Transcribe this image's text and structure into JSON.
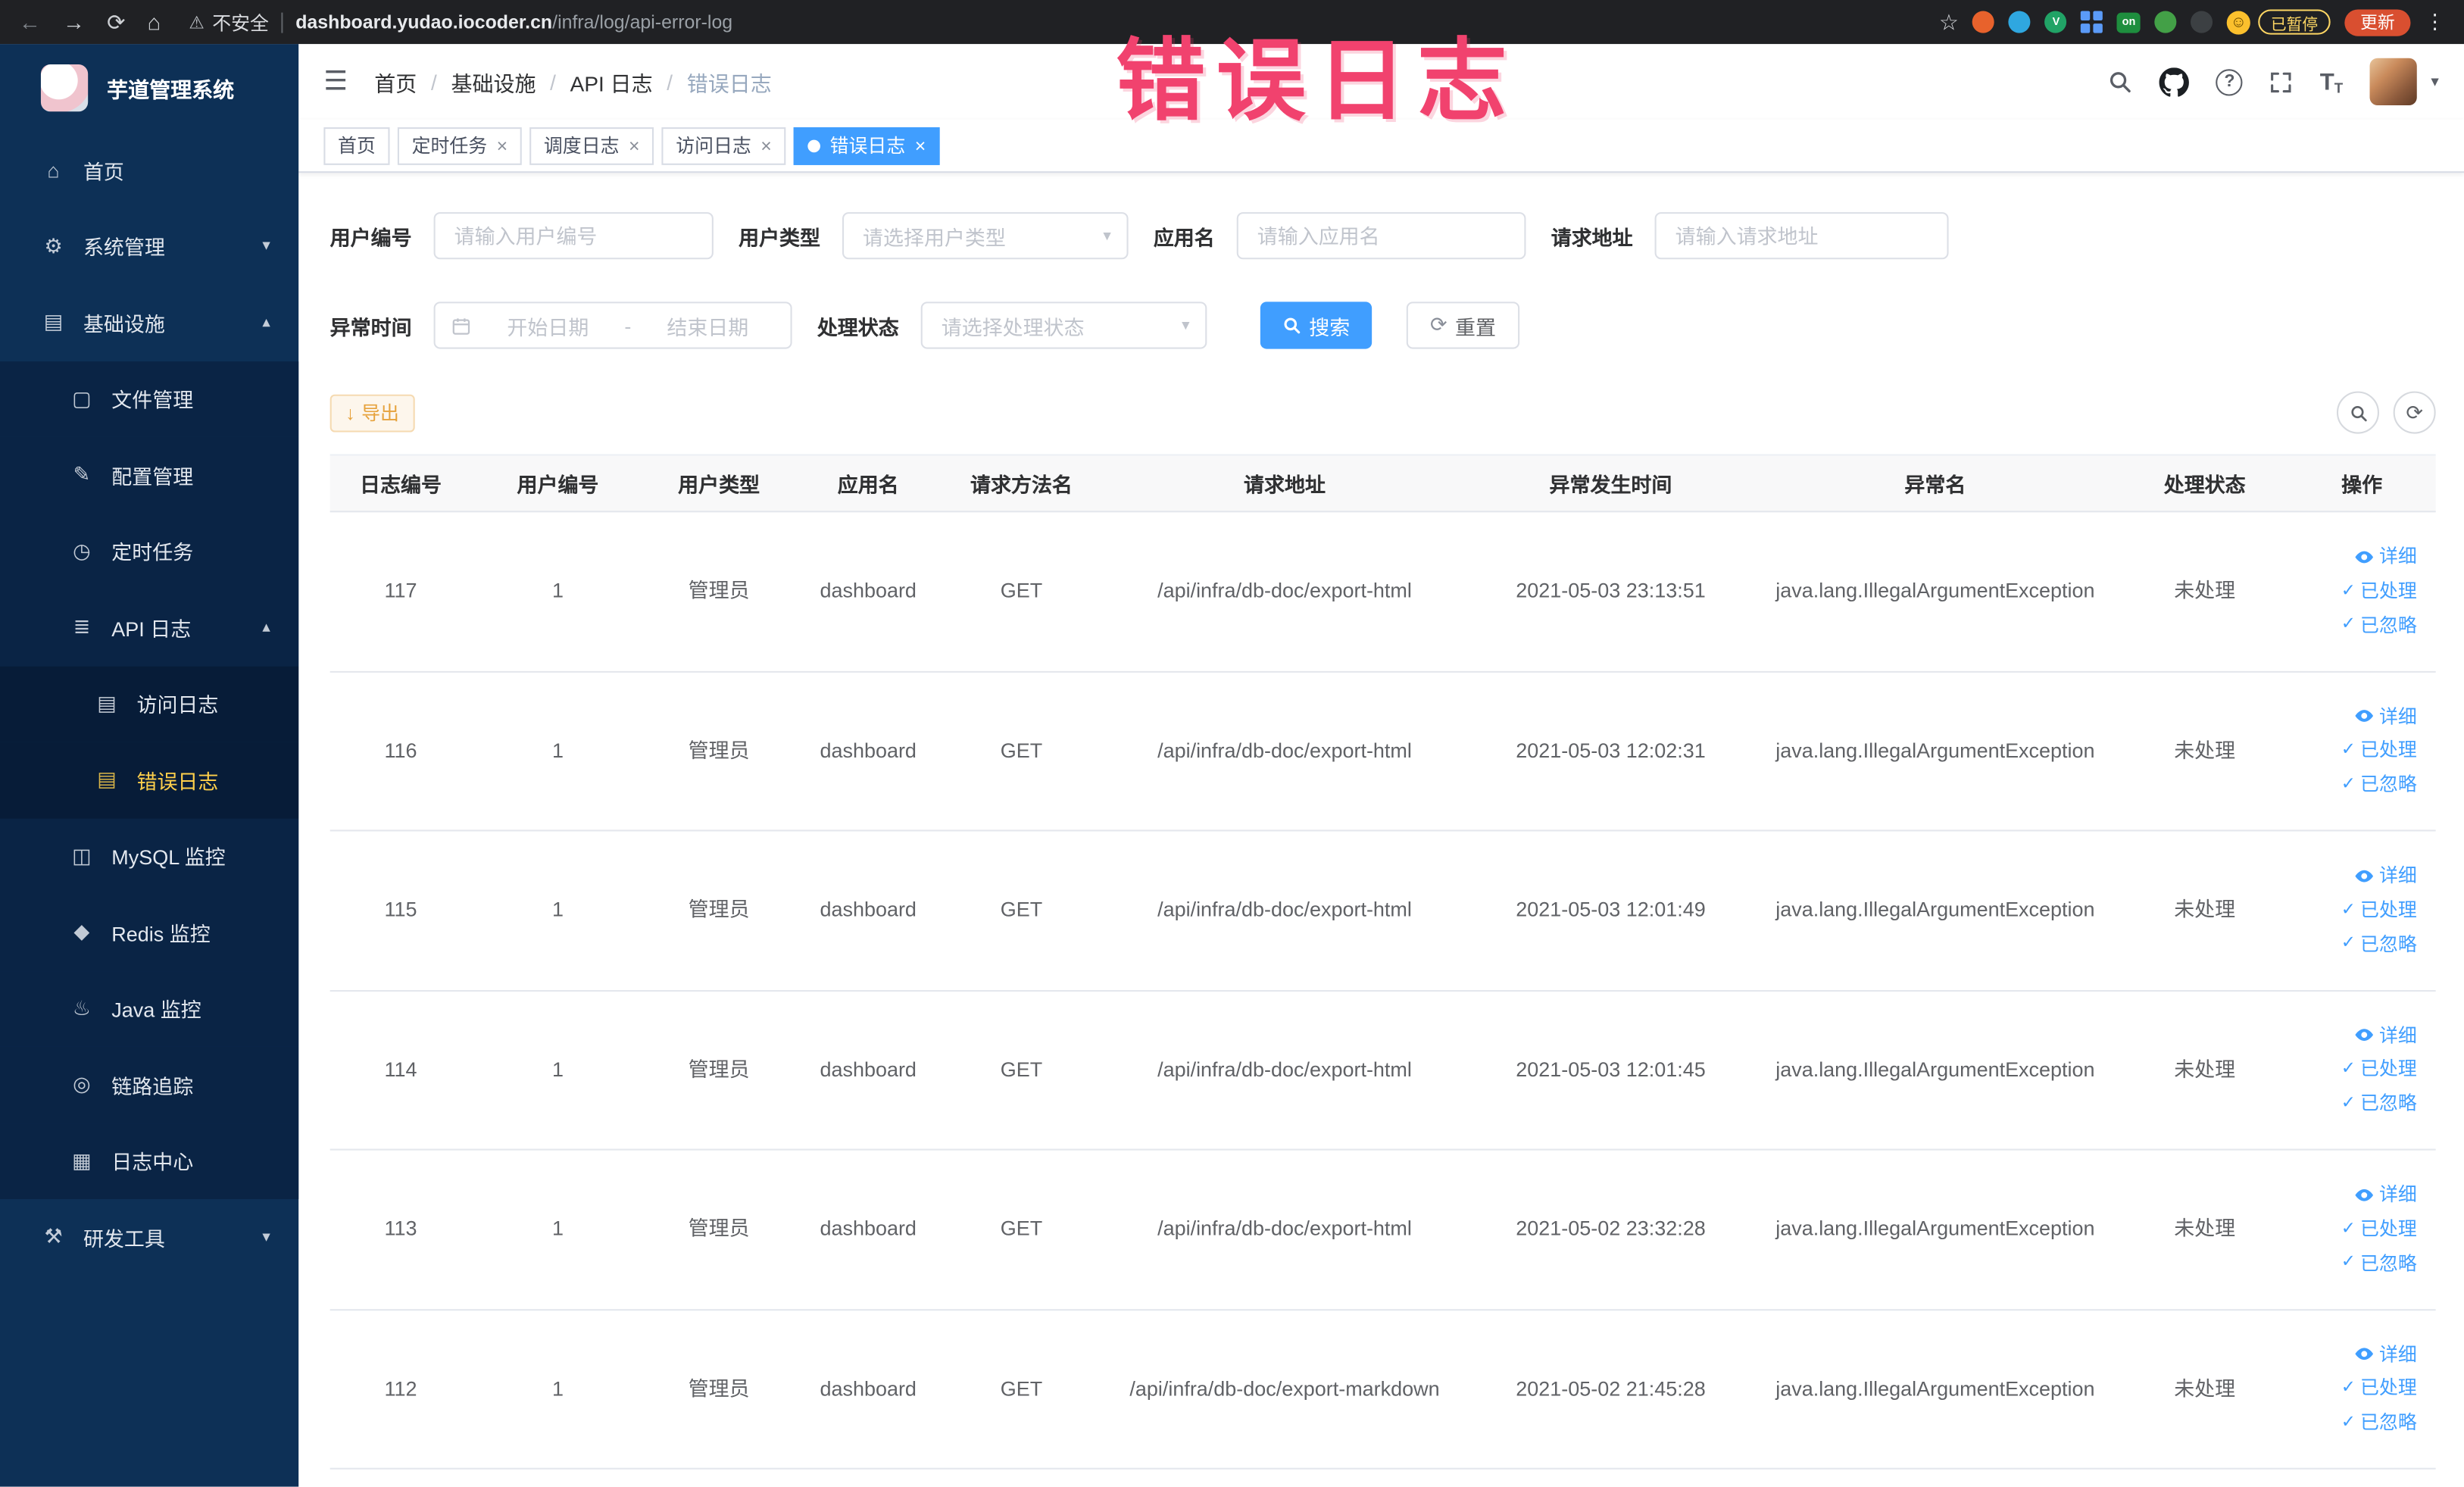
{
  "colors": {
    "accent": "#409eff",
    "warning": "#e6a23c",
    "annotation": "#f1426e",
    "sidebar_bg": "#0d3056",
    "active_menu": "#ffd04b"
  },
  "browser": {
    "security_label": "不安全",
    "url_host": "dashboard.yudao.iocoder.cn",
    "url_path": "/infra/log/api-error-log",
    "ext_v_label": "V",
    "ext_on_label": "on",
    "paused_badge": "已暂停",
    "update_button": "更新"
  },
  "annotation": {
    "text": "错误日志"
  },
  "sidebar": {
    "app_title": "芋道管理系统",
    "items": [
      {
        "label": "首页"
      },
      {
        "label": "系统管理"
      },
      {
        "label": "基础设施"
      },
      {
        "label": "文件管理"
      },
      {
        "label": "配置管理"
      },
      {
        "label": "定时任务"
      },
      {
        "label": "API 日志"
      },
      {
        "label": "访问日志"
      },
      {
        "label": "错误日志"
      },
      {
        "label": "MySQL 监控"
      },
      {
        "label": "Redis 监控"
      },
      {
        "label": "Java 监控"
      },
      {
        "label": "链路追踪"
      },
      {
        "label": "日志中心"
      },
      {
        "label": "研发工具"
      }
    ]
  },
  "breadcrumb": [
    "首页",
    "基础设施",
    "API 日志",
    "错误日志"
  ],
  "tabs": [
    {
      "label": "首页"
    },
    {
      "label": "定时任务"
    },
    {
      "label": "调度日志"
    },
    {
      "label": "访问日志"
    },
    {
      "label": "错误日志"
    }
  ],
  "filters": {
    "user_id": {
      "label": "用户编号",
      "placeholder": "请输入用户编号"
    },
    "user_type": {
      "label": "用户类型",
      "placeholder": "请选择用户类型"
    },
    "app_name": {
      "label": "应用名",
      "placeholder": "请输入应用名"
    },
    "request_url": {
      "label": "请求地址",
      "placeholder": "请输入请求地址"
    },
    "exception_time": {
      "label": "异常时间",
      "start_placeholder": "开始日期",
      "separator": "-",
      "end_placeholder": "结束日期"
    },
    "process_status": {
      "label": "处理状态",
      "placeholder": "请选择处理状态"
    },
    "search_button": "搜索",
    "reset_button": "重置"
  },
  "toolbar": {
    "export_button": "导出"
  },
  "table": {
    "columns": [
      "日志编号",
      "用户编号",
      "用户类型",
      "应用名",
      "请求方法名",
      "请求地址",
      "异常发生时间",
      "异常名",
      "处理状态",
      "操作"
    ],
    "actions": {
      "detail": "详细",
      "processed": "已处理",
      "ignored": "已忽略"
    },
    "rows": [
      {
        "id": "117",
        "user_id": "1",
        "user_type": "管理员",
        "app": "dashboard",
        "method": "GET",
        "url": "/api/infra/db-doc/export-html",
        "time": "2021-05-03 23:13:51",
        "exception": "java.lang.IllegalArgumentException",
        "status": "未处理"
      },
      {
        "id": "116",
        "user_id": "1",
        "user_type": "管理员",
        "app": "dashboard",
        "method": "GET",
        "url": "/api/infra/db-doc/export-html",
        "time": "2021-05-03 12:02:31",
        "exception": "java.lang.IllegalArgumentException",
        "status": "未处理"
      },
      {
        "id": "115",
        "user_id": "1",
        "user_type": "管理员",
        "app": "dashboard",
        "method": "GET",
        "url": "/api/infra/db-doc/export-html",
        "time": "2021-05-03 12:01:49",
        "exception": "java.lang.IllegalArgumentException",
        "status": "未处理"
      },
      {
        "id": "114",
        "user_id": "1",
        "user_type": "管理员",
        "app": "dashboard",
        "method": "GET",
        "url": "/api/infra/db-doc/export-html",
        "time": "2021-05-03 12:01:45",
        "exception": "java.lang.IllegalArgumentException",
        "status": "未处理"
      },
      {
        "id": "113",
        "user_id": "1",
        "user_type": "管理员",
        "app": "dashboard",
        "method": "GET",
        "url": "/api/infra/db-doc/export-html",
        "time": "2021-05-02 23:32:28",
        "exception": "java.lang.IllegalArgumentException",
        "status": "未处理"
      },
      {
        "id": "112",
        "user_id": "1",
        "user_type": "管理员",
        "app": "dashboard",
        "method": "GET",
        "url": "/api/infra/db-doc/export-markdown",
        "time": "2021-05-02 21:45:28",
        "exception": "java.lang.IllegalArgumentException",
        "status": "未处理"
      }
    ]
  },
  "icons": {
    "back": "←",
    "forward": "→",
    "reload": "⟳",
    "home": "⌂",
    "warning": "⚠",
    "star": "☆",
    "dots": "⋮",
    "smiley": "☺",
    "hamburger": "☰",
    "caret_down": "▾",
    "caret_up": "▴",
    "close": "×",
    "check": "✓",
    "download": "↓",
    "refresh": "⟳",
    "dash": "-",
    "font_big": "T",
    "font_small": "T",
    "s_home": "⌂",
    "s_system": "⚙",
    "s_infra": "▤",
    "s_file": "▢",
    "s_config": "✎",
    "s_job": "◷",
    "s_apilog": "≣",
    "s_accesslog": "▤",
    "s_errorlog": "▤",
    "s_mysql": "◫",
    "s_redis": "◆",
    "s_java": "♨",
    "s_trace": "◎",
    "s_logcenter": "▦",
    "s_devtools": "⚒"
  }
}
